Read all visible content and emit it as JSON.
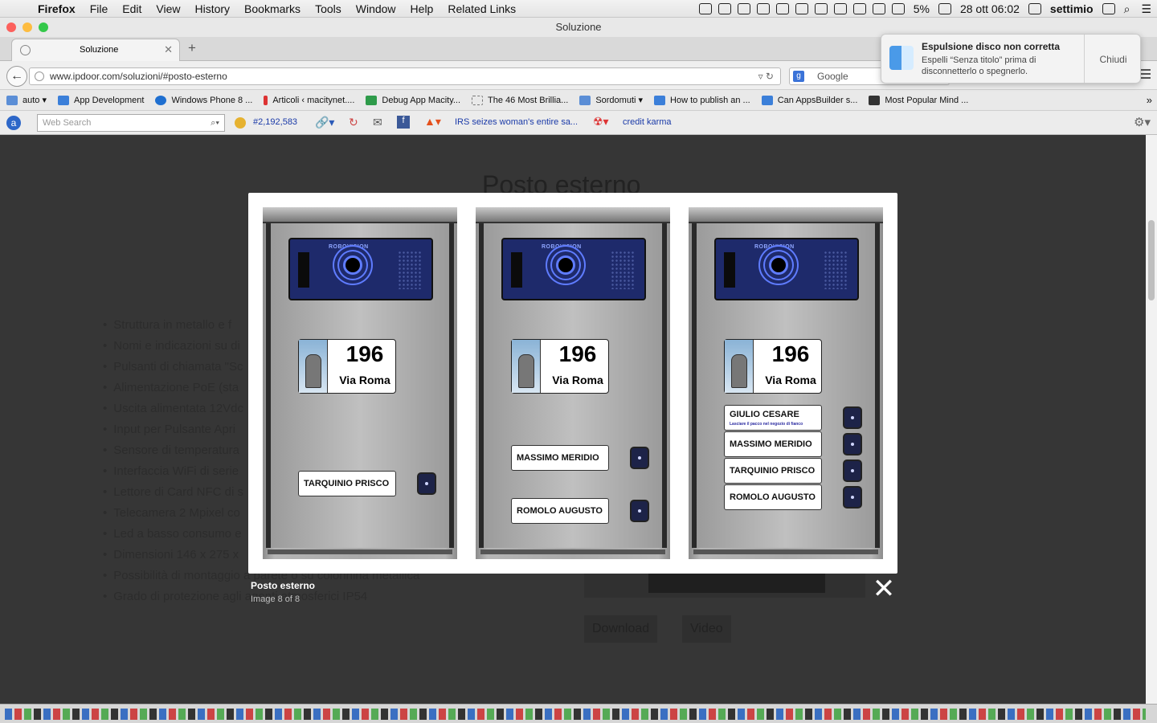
{
  "menubar": {
    "app": "Firefox",
    "items": [
      "File",
      "Edit",
      "View",
      "History",
      "Bookmarks",
      "Tools",
      "Window",
      "Help",
      "Related Links"
    ],
    "battery": "5%",
    "datetime": "28 ott  06:02",
    "user": "settimio"
  },
  "window": {
    "title": "Soluzione"
  },
  "tab": {
    "label": "Soluzione"
  },
  "address": {
    "url": "www.ipdoor.com/soluzioni/#posto-esterno"
  },
  "search": {
    "placeholder": "Google"
  },
  "bookmarks": [
    {
      "label": "auto ▾",
      "color": "#5b8ed6"
    },
    {
      "label": "App Development",
      "color": "#3b7fd9"
    },
    {
      "label": "Windows Phone 8 ...",
      "color": "#1f6fd0"
    },
    {
      "label": "Articoli ‹ macitynet....",
      "color": "#d33"
    },
    {
      "label": "Debug App Macity...",
      "color": "#2e9b4a"
    },
    {
      "label": "The 46 Most Brillia...",
      "color": "#bbb"
    },
    {
      "label": "Sordomuti ▾",
      "color": "#5b8ed6"
    },
    {
      "label": "How to publish an ...",
      "color": "#3b7fd9"
    },
    {
      "label": "Can AppsBuilder s...",
      "color": "#3b7fd9"
    },
    {
      "label": "Most Popular Mind ...",
      "color": "#333"
    }
  ],
  "toolbar2": {
    "web_search_placeholder": "Web Search",
    "rank": "#2,192,583",
    "news": "IRS seizes woman's entire sa...",
    "credit": "credit karma"
  },
  "page": {
    "title": "Posto esterno",
    "features": [
      "Struttura in metallo e f",
      "Nomi e indicazioni su di",
      "Pulsanti di chiamata \"Sc",
      "Alimentazione PoE (sta",
      "Uscita alimentata 12Vdc",
      "Input per Pulsante Apri",
      "Sensore di temperatura",
      "Interfaccia WiFi di serie",
      "Lettore di Card NFC di s",
      "Telecamera 2 Mpixel co",
      "Led a basso consumo e",
      "Dimensioni 146 x 275 x",
      "Possibilità di montaggio a parete o su colonnina metallica",
      "Grado di protezione agli agenti atmosferici IP54"
    ],
    "download": "Download",
    "video": "Video"
  },
  "lightbox": {
    "caption": "Posto esterno",
    "counter": "Image 8 of 8",
    "panels": [
      {
        "brand": "ROBOVISION",
        "number": "196",
        "street": "Via Roma",
        "names": [
          "TARQUINIO PRISCO"
        ]
      },
      {
        "brand": "ROBOVISION",
        "number": "196",
        "street": "Via Roma",
        "names": [
          "MASSIMO MERIDIO",
          "ROMOLO AUGUSTO"
        ]
      },
      {
        "brand": "ROBOVISION",
        "number": "196",
        "street": "Via Roma",
        "names": [
          "GIULIO CESARE",
          "MASSIMO MERIDIO",
          "TARQUINIO PRISCO",
          "ROMOLO AUGUSTO"
        ],
        "note": "Lasciare il pacco nel negozio di fianco"
      }
    ]
  },
  "notification": {
    "title": "Espulsione disco non corretta",
    "body": "Espelli “Senza titolo” prima di disconnetterlo o spegnerlo.",
    "button": "Chiudi"
  }
}
